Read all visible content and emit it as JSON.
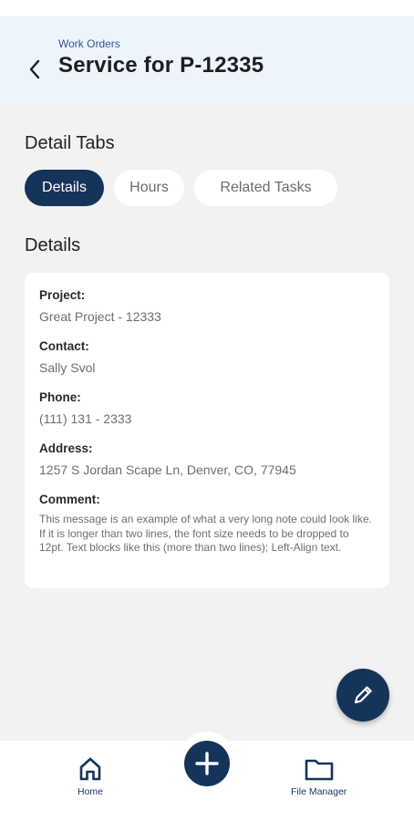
{
  "header": {
    "breadcrumb": "Work Orders",
    "title": "Service for P-12335",
    "back_icon": "chevron-left-icon"
  },
  "tabs_section": {
    "heading": "Detail Tabs",
    "tabs": [
      {
        "label": "Details",
        "active": true
      },
      {
        "label": "Hours",
        "active": false
      },
      {
        "label": "Related Tasks",
        "active": false
      }
    ]
  },
  "details": {
    "heading": "Details",
    "fields": [
      {
        "label": "Project:",
        "value": "Great Project - 12333"
      },
      {
        "label": "Contact:",
        "value": "Sally Svol"
      },
      {
        "label": "Phone:",
        "value": "(111) 131 - 2333"
      },
      {
        "label": "Address:",
        "value": "1257 S Jordan Scape Ln, Denver, CO, 77945"
      }
    ],
    "comment": {
      "label": "Comment:",
      "value": "This message is an example of what a very long note could look like. If it is longer than two lines, the font size needs to be dropped to 12pt. Text blocks like this (more than two lines); Left-Align text."
    }
  },
  "fab": {
    "edit_icon": "pencil-icon",
    "add_icon": "plus-icon"
  },
  "bottom_nav": {
    "items": [
      {
        "label": "Home",
        "icon": "home-icon"
      },
      {
        "label": "File Manager",
        "icon": "folder-icon"
      }
    ]
  },
  "colors": {
    "primary": "#15345a",
    "header_bg": "#eef4fb",
    "page_bg": "#f2f2f2",
    "breadcrumb": "#2d5a8a"
  }
}
